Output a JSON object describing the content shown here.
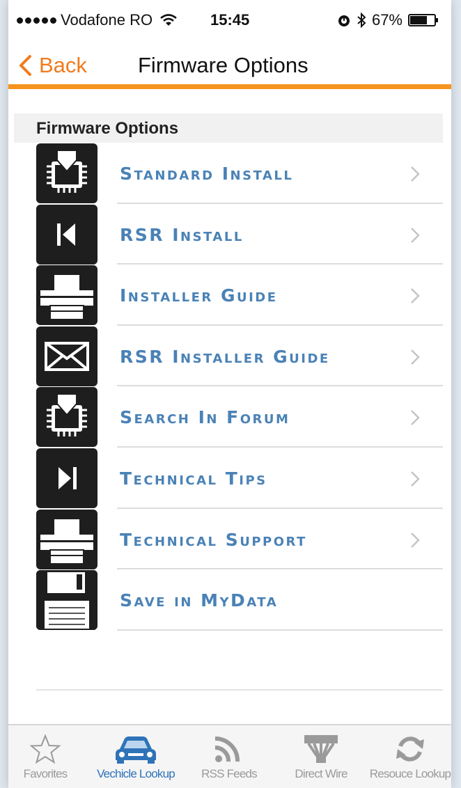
{
  "status_bar": {
    "carrier": "Vodafone RO",
    "time": "15:45",
    "battery": "67%"
  },
  "nav": {
    "back_label": "Back",
    "title": "Firmware Options"
  },
  "section_header": "Firmware Options",
  "items": [
    {
      "label": "Standard Install",
      "icon": "chip-download-icon",
      "chevron": true
    },
    {
      "label": "RSR Install",
      "icon": "skip-back-icon",
      "chevron": true
    },
    {
      "label": "Installer Guide",
      "icon": "printer-icon",
      "chevron": true
    },
    {
      "label": "RSR Installer Guide",
      "icon": "envelope-icon",
      "chevron": true
    },
    {
      "label": "Search In Forum",
      "icon": "chip-download-icon",
      "chevron": true
    },
    {
      "label": "Technical Tips",
      "icon": "skip-forward-icon",
      "chevron": true
    },
    {
      "label": "Technical Support",
      "icon": "printer-icon",
      "chevron": true
    },
    {
      "label": "Save in MyData",
      "icon": "floppy-disk-icon",
      "chevron": false
    }
  ],
  "tabs": [
    {
      "label": "Favorites",
      "icon": "star-icon",
      "active": false
    },
    {
      "label": "Vechicle Lookup",
      "icon": "car-icon",
      "active": true
    },
    {
      "label": "RSS Feeds",
      "icon": "rss-icon",
      "active": false
    },
    {
      "label": "Direct Wire",
      "icon": "wire-connector-icon",
      "active": false
    },
    {
      "label": "Resouce Lookup",
      "icon": "refresh-icon",
      "active": false
    }
  ],
  "colors": {
    "accent_orange": "#f7941d",
    "label_blue": "#4a82b6",
    "active_tab_blue": "#2e73b8"
  }
}
